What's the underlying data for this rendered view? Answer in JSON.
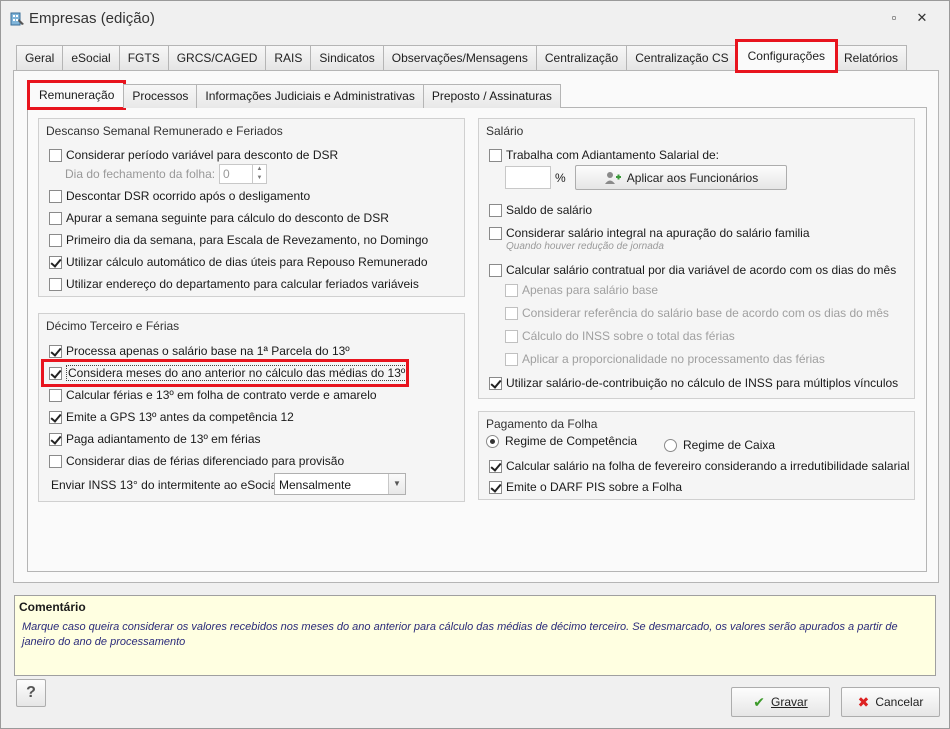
{
  "window": {
    "title": "Empresas (edição)"
  },
  "main_tabs": [
    {
      "label": "Geral"
    },
    {
      "label": "eSocial"
    },
    {
      "label": "FGTS"
    },
    {
      "label": "GRCS/CAGED"
    },
    {
      "label": "RAIS"
    },
    {
      "label": "Sindicatos"
    },
    {
      "label": "Observações/Mensagens"
    },
    {
      "label": "Centralização"
    },
    {
      "label": "Centralização CS"
    },
    {
      "label": "Configurações"
    },
    {
      "label": "Relatórios"
    }
  ],
  "sub_tabs": [
    {
      "label": "Remuneração"
    },
    {
      "label": "Processos"
    },
    {
      "label": "Informações Judiciais e Administrativas"
    },
    {
      "label": "Preposto / Assinaturas"
    }
  ],
  "dsr": {
    "title": "Descanso Semanal Remunerado e Feriados",
    "items": [
      {
        "label": "Considerar período variável para desconto de DSR",
        "checked": false
      },
      {
        "label": "Descontar DSR ocorrido após o desligamento",
        "checked": false
      },
      {
        "label": "Apurar a semana seguinte para cálculo do desconto de DSR",
        "checked": false
      },
      {
        "label": "Primeiro dia da semana, para Escala de Revezamento, no Domingo",
        "checked": false
      },
      {
        "label": "Utilizar cálculo automático de dias úteis para Repouso Remunerado",
        "checked": true
      },
      {
        "label": "Utilizar endereço do departamento para calcular feriados variáveis",
        "checked": false
      }
    ],
    "closing_day_label": "Dia do fechamento da folha:",
    "closing_day_value": "0"
  },
  "decimo": {
    "title": "Décimo Terceiro e Férias",
    "items": [
      {
        "label": "Processa apenas o salário base na 1ª Parcela do 13º",
        "checked": true
      },
      {
        "label": "Considera meses do ano anterior no cálculo das médias do 13º",
        "checked": true
      },
      {
        "label": "Calcular férias e 13º em folha de contrato verde e amarelo",
        "checked": false
      },
      {
        "label": "Emite a GPS 13º antes da competência 12",
        "checked": true
      },
      {
        "label": "Paga adiantamento de 13º em férias",
        "checked": true
      },
      {
        "label": "Considerar dias de férias diferenciado para provisão",
        "checked": false
      }
    ],
    "inss_label": "Enviar INSS 13° do intermitente ao eSocial",
    "inss_value": "Mensalmente"
  },
  "salario": {
    "title": "Salário",
    "adiantamento_label": "Trabalha com Adiantamento Salarial de:",
    "percent_symbol": "%",
    "apply_button": "Aplicar aos Funcionários",
    "saldo_label": "Saldo de salário",
    "integral_label": "Considerar salário integral na apuração do salário familia",
    "integral_hint": "Quando houver redução de jornada",
    "contratual_label": "Calcular salário contratual por dia variável de acordo com os dias do mês",
    "sub_items": [
      {
        "label": "Apenas para salário base"
      },
      {
        "label": "Considerar referência do salário base de acordo com os dias do mês"
      },
      {
        "label": "Cálculo do INSS sobre o total das férias"
      },
      {
        "label": "Aplicar a proporcionalidade no processamento das férias"
      }
    ],
    "contribuicao_label": "Utilizar salário-de-contribuição no cálculo de INSS para múltiplos vínculos"
  },
  "pagamento": {
    "title": "Pagamento da Folha",
    "radio_competencia": "Regime de Competência",
    "radio_caixa": "Regime de Caixa",
    "fevereiro_label": "Calcular salário na folha de fevereiro considerando a irredutibilidade salarial",
    "darf_label": "Emite o DARF PIS sobre a Folha"
  },
  "comment": {
    "title": "Comentário",
    "text": "Marque caso queira considerar os valores recebidos nos meses do ano anterior para cálculo das médias de décimo terceiro. Se desmarcado, os valores serão apurados a partir de janeiro do ano de processamento"
  },
  "footer": {
    "help_label": "?",
    "save_label": "Gravar",
    "cancel_label": "Cancelar"
  }
}
